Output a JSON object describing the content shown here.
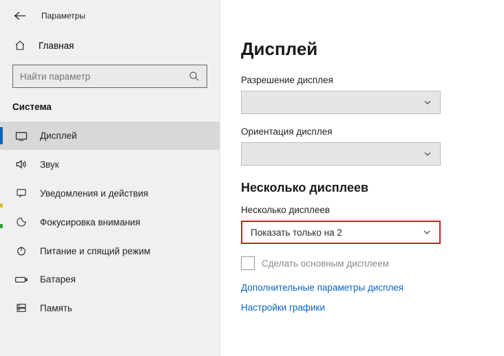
{
  "header": {
    "app_title": "Параметры"
  },
  "sidebar": {
    "home_label": "Главная",
    "search": {
      "placeholder": "Найти параметр"
    },
    "section_label": "Система",
    "items": [
      {
        "label": "Дисплей",
        "icon": "display-icon",
        "active": true
      },
      {
        "label": "Звук",
        "icon": "sound-icon"
      },
      {
        "label": "Уведомления и действия",
        "icon": "notifications-icon"
      },
      {
        "label": "Фокусировка внимания",
        "icon": "focus-icon"
      },
      {
        "label": "Питание и спящий режим",
        "icon": "power-icon"
      },
      {
        "label": "Батарея",
        "icon": "battery-icon"
      },
      {
        "label": "Память",
        "icon": "storage-icon"
      }
    ]
  },
  "main": {
    "title": "Дисплей",
    "resolution_label": "Разрешение дисплея",
    "resolution_value": "",
    "orientation_label": "Ориентация дисплея",
    "orientation_value": "",
    "multi_heading": "Несколько дисплеев",
    "multi_label": "Несколько дисплеев",
    "multi_value": "Показать только на 2",
    "checkbox_label": "Сделать основным дисплеем",
    "link_advanced": "Дополнительные параметры дисплея",
    "link_graphics": "Настройки графики"
  }
}
